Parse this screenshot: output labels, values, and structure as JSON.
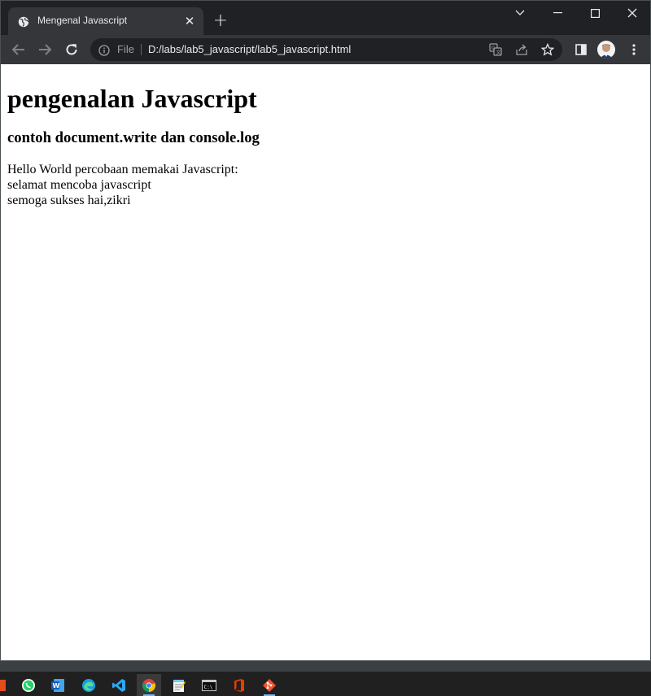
{
  "browser": {
    "tab_title": "Mengenal Javascript",
    "scheme_label": "File",
    "url": "D:/labs/lab5_javascript/lab5_javascript.html"
  },
  "page": {
    "heading": "pengenalan Javascript",
    "subheading": "contoh document.write dan console.log",
    "lines": [
      "Hello World percobaan memakai Javascript:",
      "selamat mencoba javascript",
      "semoga sukses hai,zikri"
    ]
  },
  "colors": {
    "titlebar": "#202124",
    "toolbar": "#35363a",
    "omnibox": "#202124",
    "page_background": "#ffffff",
    "taskbar": "#202020",
    "taskbar_active_indicator": "#76b9ed"
  },
  "taskbar": {
    "apps": [
      "office-icon",
      "whatsapp-icon",
      "word-icon",
      "edge-icon",
      "vscode-icon",
      "chrome-icon",
      "notepad-icon",
      "terminal-icon",
      "office365-icon",
      "git-icon"
    ],
    "active_app": "chrome-icon"
  }
}
